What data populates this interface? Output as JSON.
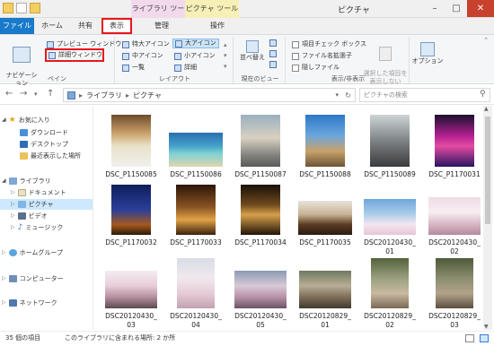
{
  "window": {
    "title": "ピクチャ"
  },
  "context_groups": {
    "library_tools": "ライブラリ ツール",
    "picture_tools": "ピクチャ ツール"
  },
  "tabs": {
    "file": "ファイル",
    "home": "ホーム",
    "share": "共有",
    "view": "表示",
    "manage": "管理",
    "operate": "操作"
  },
  "ribbon": {
    "pane": {
      "nav_pane": "ナビゲーション\nウィンドウ ▾",
      "preview_pane": "プレビュー ウィンドウ",
      "details_pane": "詳細ウィンドウ",
      "label": "ペイン"
    },
    "layout": {
      "items": [
        "特大アイコン",
        "大アイコン",
        "中アイコン",
        "小アイコン",
        "一覧",
        "詳細"
      ],
      "label": "レイアウト"
    },
    "current_view": {
      "sort": "並べ替え",
      "label": "現在のビュー"
    },
    "show_hide": {
      "item_checkboxes": "項目チェック ボックス",
      "file_ext": "ファイル名拡張子",
      "hidden_files": "隠しファイル",
      "hide_selected": "選択した項目を\n表示しない",
      "label": "表示/非表示"
    },
    "options": "オプション"
  },
  "address": {
    "path_root": "ライブラリ",
    "path_leaf": "ピクチャ",
    "search_placeholder": "ピクチャの検索"
  },
  "nav": {
    "favorites": "お気に入り",
    "downloads": "ダウンロード",
    "desktop": "デスクトップ",
    "recent": "最近表示した場所",
    "libraries": "ライブラリ",
    "documents": "ドキュメント",
    "pictures": "ピクチャ",
    "videos": "ビデオ",
    "music": "ミュージック",
    "homegroup": "ホームグループ",
    "computer": "コンピューター",
    "network": "ネットワーク"
  },
  "files": [
    {
      "line1": "DSC_P1150085",
      "line2": ""
    },
    {
      "line1": "DSC_P1150086",
      "line2": ""
    },
    {
      "line1": "DSC_P1150087",
      "line2": ""
    },
    {
      "line1": "DSC_P1150088",
      "line2": ""
    },
    {
      "line1": "DSC_P1150089",
      "line2": ""
    },
    {
      "line1": "DSC_P1170031",
      "line2": ""
    },
    {
      "line1": "DSC_P1170032",
      "line2": ""
    },
    {
      "line1": "DSC_P1170033",
      "line2": ""
    },
    {
      "line1": "DSC_P1170034",
      "line2": ""
    },
    {
      "line1": "DSC_P1170035",
      "line2": ""
    },
    {
      "line1": "DSC20120430_",
      "line2": "01"
    },
    {
      "line1": "DSC20120430_",
      "line2": "02"
    },
    {
      "line1": "DSC20120430_",
      "line2": "03"
    },
    {
      "line1": "DSC20120430_",
      "line2": "04"
    },
    {
      "line1": "DSC20120430_",
      "line2": "05"
    },
    {
      "line1": "DSC20120829_",
      "line2": "01"
    },
    {
      "line1": "DSC20120829_",
      "line2": "02"
    },
    {
      "line1": "DSC20120829_",
      "line2": "03"
    }
  ],
  "status": {
    "count": "35 個の項目",
    "library_info": "このライブラリに含まれる場所: 2 か所"
  }
}
